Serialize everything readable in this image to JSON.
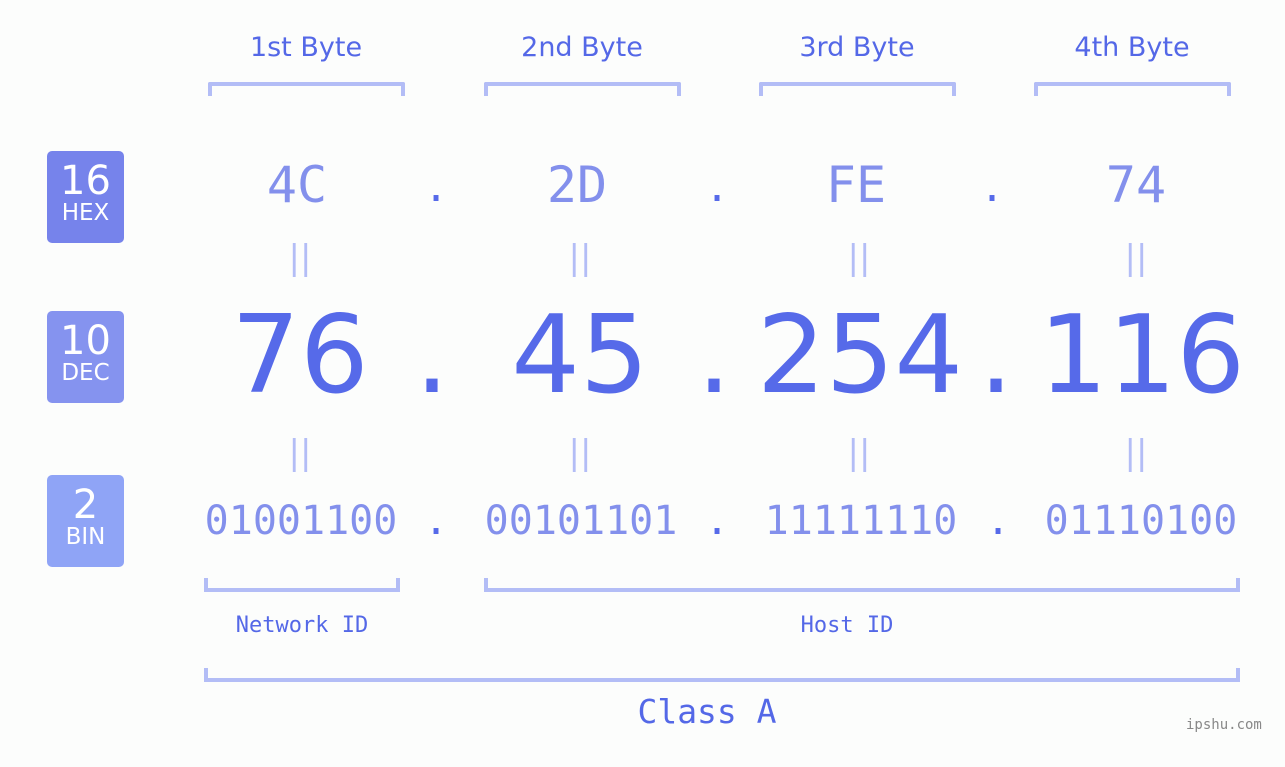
{
  "bytes": [
    {
      "label": "1st Byte",
      "hex": "4C",
      "dec": "76",
      "bin": "01001100"
    },
    {
      "label": "2nd Byte",
      "hex": "2D",
      "dec": "45",
      "bin": "00101101"
    },
    {
      "label": "3rd Byte",
      "hex": "FE",
      "dec": "254",
      "bin": "11111110"
    },
    {
      "label": "4th Byte",
      "hex": "74",
      "dec": "116",
      "bin": "01110100"
    }
  ],
  "separator": ".",
  "equals": "||",
  "badges": {
    "hex": {
      "base": "16",
      "name": "HEX",
      "color": "#7683eb"
    },
    "dec": {
      "base": "10",
      "name": "DEC",
      "color": "#8593ef"
    },
    "bin": {
      "base": "2",
      "name": "BIN",
      "color": "#8fa4f6"
    }
  },
  "network_label": "Network ID",
  "host_label": "Host ID",
  "class_label": "Class A",
  "watermark": "ipshu.com",
  "colors": {
    "accent": "#566ae9",
    "light": "#8390ec",
    "bracket": "#b3bdf6"
  }
}
